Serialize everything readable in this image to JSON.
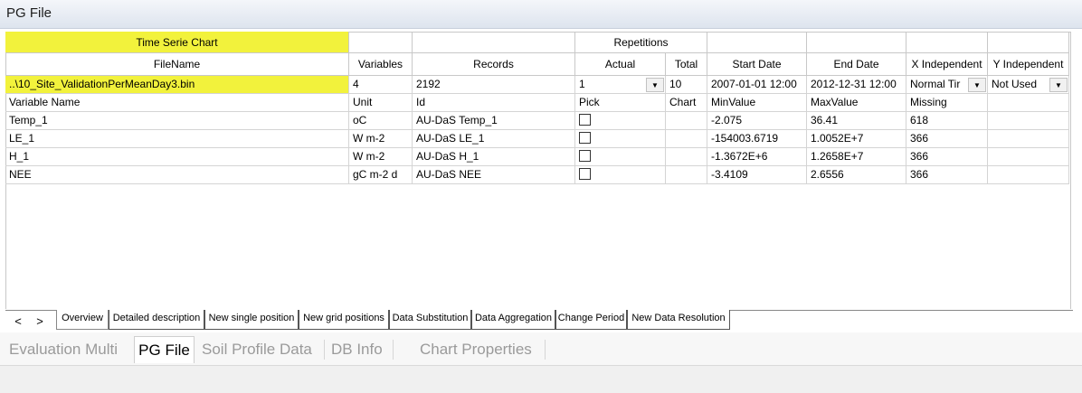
{
  "window": {
    "title": "PG File"
  },
  "header": {
    "time_serie_chart": "Time Serie Chart",
    "repetitions": "Repetitions",
    "filename": "FileName",
    "variables": "Variables",
    "records": "Records",
    "actual": "Actual",
    "total": "Total",
    "start_date": "Start Date",
    "end_date": "End Date",
    "x_independent": "X Independent",
    "y_independent": "Y Independent"
  },
  "file_row": {
    "filename": "..\\10_Site_ValidationPerMeanDay3.bin",
    "variables": "4",
    "records": "2192",
    "actual": "1",
    "total": "10",
    "start_date": "2007-01-01 12:00",
    "end_date": "2012-12-31 12:00",
    "x_independent": "Normal Tir",
    "y_independent": "Not Used"
  },
  "var_header": {
    "variable_name": "Variable Name",
    "unit": "Unit",
    "id": "Id",
    "pick": "Pick",
    "chart": "Chart",
    "min": "MinValue",
    "max": "MaxValue",
    "missing": "Missing"
  },
  "variables": [
    {
      "name": "Temp_1",
      "unit": "oC",
      "id": "AU-DaS Temp_1",
      "min": "-2.075",
      "max": "36.41",
      "missing": "618"
    },
    {
      "name": "LE_1",
      "unit": "W m-2",
      "id": "AU-DaS LE_1",
      "min": "-154003.6719",
      "max": "1.0052E+7",
      "missing": "366"
    },
    {
      "name": "H_1",
      "unit": "W m-2",
      "id": "AU-DaS H_1",
      "min": "-1.3672E+6",
      "max": "1.2658E+7",
      "missing": "366"
    },
    {
      "name": "NEE",
      "unit": "gC m-2 d",
      "id": "AU-DaS NEE",
      "min": "-3.4109",
      "max": "2.6556",
      "missing": "366"
    }
  ],
  "sub_tabs": {
    "prev": "<",
    "next": ">",
    "overview": "Overview",
    "detailed": "Detailed description",
    "single": "New single position",
    "grid": "New grid positions",
    "substitution": "Data Substitution",
    "aggregation": "Data Aggregation",
    "change_period": "Change Period",
    "resolution": "New Data Resolution"
  },
  "bottom_tabs": {
    "eval": "Evaluation Multi",
    "pg": "PG File",
    "soil": "Soil Profile Data",
    "db": "DB Info",
    "chart": "Chart Properties"
  },
  "colors": {
    "highlight": "#f2f23c",
    "dropdown_arrow": "chevron-down-icon"
  }
}
